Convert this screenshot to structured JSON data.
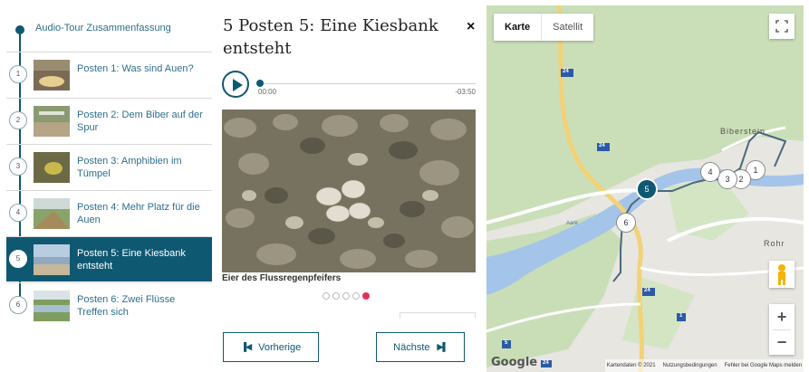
{
  "sidebar": {
    "summary_label": "Audio-Tour Zusammenfassung",
    "items": [
      {
        "num": "1",
        "label": "Posten 1: Was sind Auen?"
      },
      {
        "num": "2",
        "label": "Posten 2: Dem Biber auf der Spur"
      },
      {
        "num": "3",
        "label": "Posten 3: Amphibien im Tümpel"
      },
      {
        "num": "4",
        "label": "Posten 4: Mehr Platz für die Auen"
      },
      {
        "num": "5",
        "label": "Posten 5: Eine Kiesbank entsteht"
      },
      {
        "num": "6",
        "label": "Posten 6: Zwei Flüsse Treffen sich"
      }
    ],
    "active_index": 4
  },
  "detail": {
    "title": "5 Posten 5: Eine Kiesbank entsteht",
    "close_icon": "×",
    "audio": {
      "current": "00:00",
      "remaining": "-03:50",
      "progress": 0
    },
    "photo_caption": "Eier des Flussregenpfeifers",
    "carousel": {
      "count": 5,
      "active": 4
    },
    "prev_label": "Vorherige",
    "next_label": "Nächste"
  },
  "map": {
    "type_options": [
      "Karte",
      "Satellit"
    ],
    "selected_type": "Karte",
    "markers": [
      "1",
      "2",
      "3",
      "4",
      "5",
      "6"
    ],
    "active_marker": "5",
    "labels": {
      "biberstein": "Biberstein",
      "rohr": "Rohr",
      "aare": "Aare",
      "road_24a": "24",
      "road_24b": "24",
      "road_24c": "24",
      "road_5": "5",
      "road_1": "1",
      "road_24d": "24"
    },
    "logo": "Google",
    "attribution": [
      "Kartendaten © 2021",
      "Nutzungsbedingungen",
      "Fehler bei Google Maps melden"
    ],
    "colors": {
      "river": "#9fc0e8",
      "green": "#c9dfb5",
      "route": "#4a6a7a",
      "road": "#f7d57a"
    }
  },
  "colors": {
    "accent": "#0e5872",
    "carousel_active": "#e23155"
  }
}
